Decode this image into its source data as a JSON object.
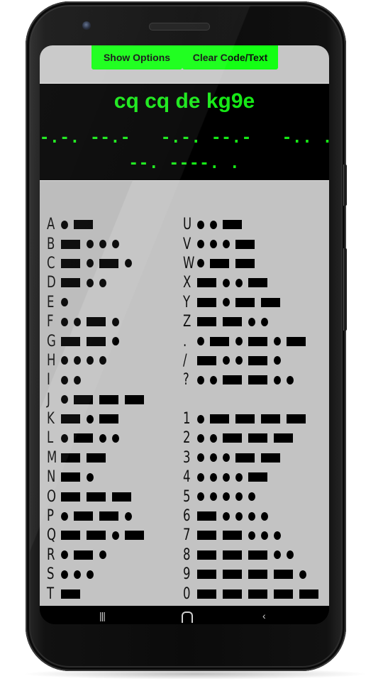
{
  "toolbar": {
    "show_options_label": "Show  Options",
    "clear_label": "Clear Code/Text"
  },
  "display": {
    "plain_text": "cq cq de kg9e",
    "morse_line1": "-.-. --.-   -.-. --.-   -.. .   -.-",
    "morse_line2": "--. ----. ."
  },
  "chart_left": [
    {
      "char": "A",
      "code": ".-"
    },
    {
      "char": "B",
      "code": "-..."
    },
    {
      "char": "C",
      "code": "-.-."
    },
    {
      "char": "D",
      "code": "-.."
    },
    {
      "char": "E",
      "code": "."
    },
    {
      "char": "F",
      "code": "..-."
    },
    {
      "char": "G",
      "code": "--."
    },
    {
      "char": "H",
      "code": "...."
    },
    {
      "char": "I",
      "code": ".."
    },
    {
      "char": "J",
      "code": ".---"
    },
    {
      "char": "K",
      "code": "-.-"
    },
    {
      "char": "L",
      "code": ".-.."
    },
    {
      "char": "M",
      "code": "--"
    },
    {
      "char": "N",
      "code": "-."
    },
    {
      "char": "O",
      "code": "---"
    },
    {
      "char": "P",
      "code": ".--."
    },
    {
      "char": "Q",
      "code": "--.-"
    },
    {
      "char": "R",
      "code": ".-."
    },
    {
      "char": "S",
      "code": "..."
    },
    {
      "char": "T",
      "code": "-"
    }
  ],
  "chart_right": [
    {
      "char": "U",
      "code": "..-"
    },
    {
      "char": "V",
      "code": "...-"
    },
    {
      "char": "W",
      "code": ".--"
    },
    {
      "char": "X",
      "code": "-..-"
    },
    {
      "char": "Y",
      "code": "-.--"
    },
    {
      "char": "Z",
      "code": "--.."
    },
    {
      "char": ".",
      "code": ".-.-.-"
    },
    {
      "char": "/",
      "code": "-..-."
    },
    {
      "char": "?",
      "code": "..--.."
    },
    {
      "char": "",
      "code": ""
    },
    {
      "char": "1",
      "code": ".----"
    },
    {
      "char": "2",
      "code": "..---"
    },
    {
      "char": "3",
      "code": "...--"
    },
    {
      "char": "4",
      "code": "....-"
    },
    {
      "char": "5",
      "code": "....."
    },
    {
      "char": "6",
      "code": "-...."
    },
    {
      "char": "7",
      "code": "--..."
    },
    {
      "char": "8",
      "code": "---.."
    },
    {
      "char": "9",
      "code": "----."
    },
    {
      "char": "0",
      "code": "-----"
    }
  ],
  "navbar": {
    "recent_icon": "|||",
    "home_icon": "home-icon",
    "back_icon": "‹"
  },
  "colors": {
    "accent_green": "#14ff14",
    "text_green": "#16e816",
    "chart_background": "#c3c3c3"
  }
}
